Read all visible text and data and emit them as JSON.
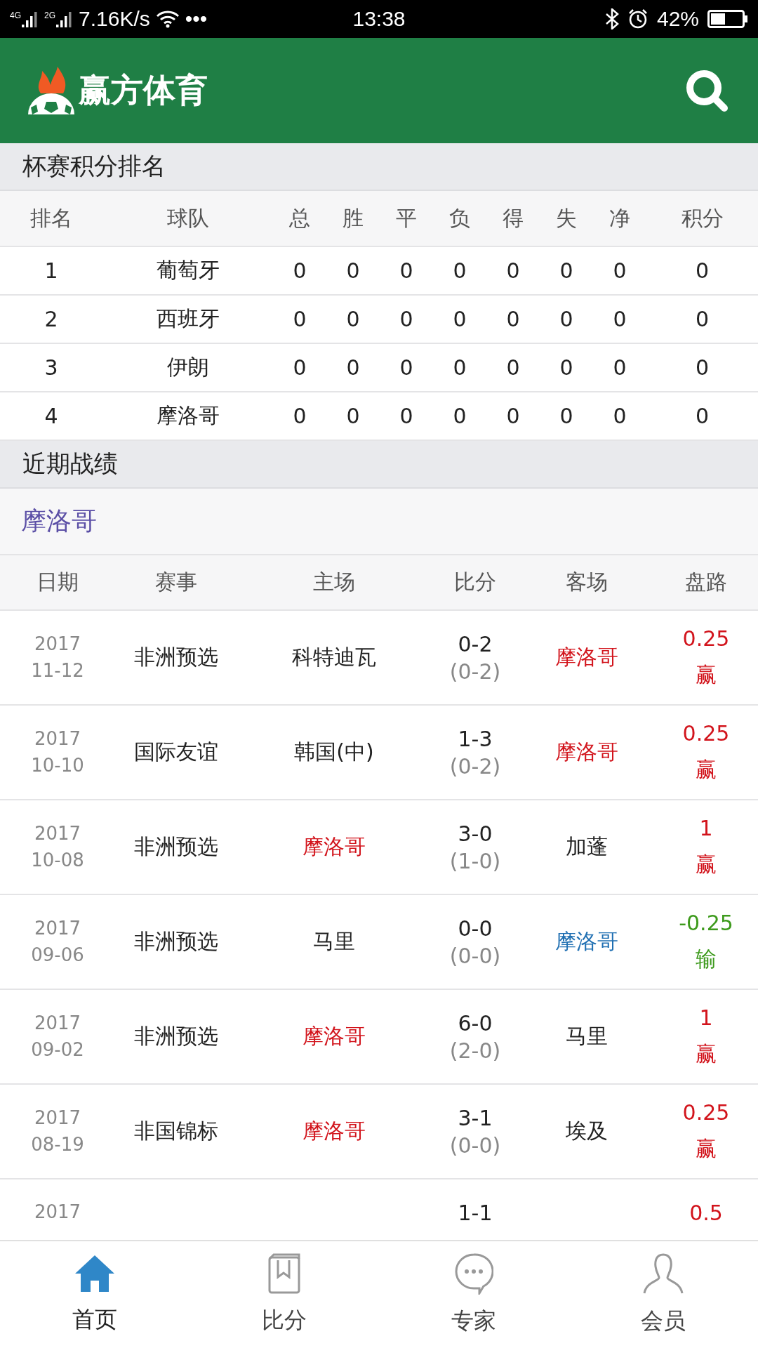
{
  "status_bar": {
    "network_1": "4G",
    "network_2": "2G",
    "speed": "7.16K/s",
    "more": "•••",
    "time": "13:38",
    "battery": "42%"
  },
  "header": {
    "brand": "赢方体育"
  },
  "standings": {
    "title": "杯赛积分排名",
    "columns": [
      "排名",
      "球队",
      "总",
      "胜",
      "平",
      "负",
      "得",
      "失",
      "净",
      "积分"
    ],
    "rows": [
      [
        "1",
        "葡萄牙",
        "0",
        "0",
        "0",
        "0",
        "0",
        "0",
        "0",
        "0"
      ],
      [
        "2",
        "西班牙",
        "0",
        "0",
        "0",
        "0",
        "0",
        "0",
        "0",
        "0"
      ],
      [
        "3",
        "伊朗",
        "0",
        "0",
        "0",
        "0",
        "0",
        "0",
        "0",
        "0"
      ],
      [
        "4",
        "摩洛哥",
        "0",
        "0",
        "0",
        "0",
        "0",
        "0",
        "0",
        "0"
      ]
    ]
  },
  "recent": {
    "title": "近期战绩",
    "team": "摩洛哥",
    "columns": [
      "日期",
      "赛事",
      "主场",
      "比分",
      "客场",
      "盘路"
    ],
    "rows": [
      {
        "year": "2017",
        "date": "11-12",
        "event": "非洲预选",
        "home": {
          "name": "科特迪瓦",
          "color": "#222222"
        },
        "score": "0-2",
        "half": "(0-2)",
        "away": {
          "name": "摩洛哥",
          "color": "#d2141c"
        },
        "line": {
          "value": "0.25",
          "result": "赢",
          "color": "#d2141c"
        }
      },
      {
        "year": "2017",
        "date": "10-10",
        "event": "国际友谊",
        "home": {
          "name": "韩国(中)",
          "color": "#222222"
        },
        "score": "1-3",
        "half": "(0-2)",
        "away": {
          "name": "摩洛哥",
          "color": "#d2141c"
        },
        "line": {
          "value": "0.25",
          "result": "赢",
          "color": "#d2141c"
        }
      },
      {
        "year": "2017",
        "date": "10-08",
        "event": "非洲预选",
        "home": {
          "name": "摩洛哥",
          "color": "#d2141c"
        },
        "score": "3-0",
        "half": "(1-0)",
        "away": {
          "name": "加蓬",
          "color": "#222222"
        },
        "line": {
          "value": "1",
          "result": "赢",
          "color": "#d2141c"
        }
      },
      {
        "year": "2017",
        "date": "09-06",
        "event": "非洲预选",
        "home": {
          "name": "马里",
          "color": "#222222"
        },
        "score": "0-0",
        "half": "(0-0)",
        "away": {
          "name": "摩洛哥",
          "color": "#1f6fb2"
        },
        "line": {
          "value": "-0.25",
          "result": "输",
          "color": "#3d9a1c"
        }
      },
      {
        "year": "2017",
        "date": "09-02",
        "event": "非洲预选",
        "home": {
          "name": "摩洛哥",
          "color": "#d2141c"
        },
        "score": "6-0",
        "half": "(2-0)",
        "away": {
          "name": "马里",
          "color": "#222222"
        },
        "line": {
          "value": "1",
          "result": "赢",
          "color": "#d2141c"
        }
      },
      {
        "year": "2017",
        "date": "08-19",
        "event": "非国锦标",
        "home": {
          "name": "摩洛哥",
          "color": "#d2141c"
        },
        "score": "3-1",
        "half": "(0-0)",
        "away": {
          "name": "埃及",
          "color": "#222222"
        },
        "line": {
          "value": "0.25",
          "result": "赢",
          "color": "#d2141c"
        }
      },
      {
        "year": "2017",
        "score": "1-1",
        "line": {
          "value": "0.5",
          "color": "#d2141c"
        }
      }
    ]
  },
  "nav": [
    {
      "label": "首页",
      "selected": true
    },
    {
      "label": "比分",
      "selected": false
    },
    {
      "label": "专家",
      "selected": false
    },
    {
      "label": "会员",
      "selected": false
    }
  ]
}
